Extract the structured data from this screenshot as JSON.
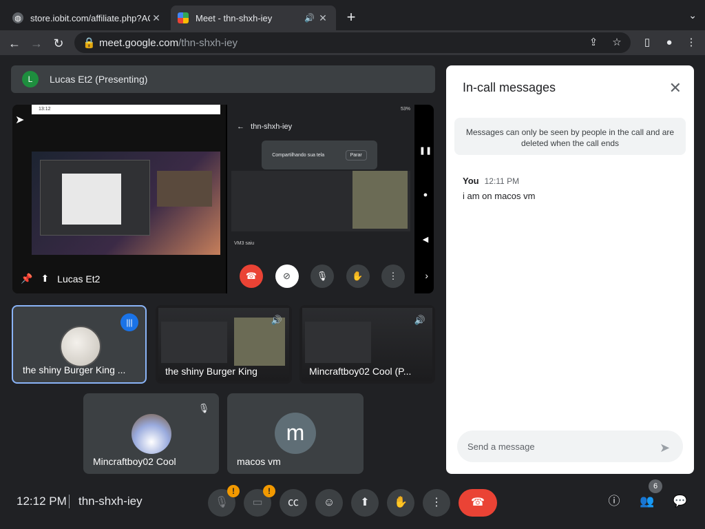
{
  "browser": {
    "tabs": [
      {
        "title": "store.iobit.com/affiliate.php?AC",
        "active": false
      },
      {
        "title": "Meet - thn-shxh-iey",
        "active": true
      }
    ],
    "url_host": "meet.google.com",
    "url_path": "/thn-shxh-iey"
  },
  "stage": {
    "presenter_initial": "L",
    "presenter_label": "Lucas Et2 (Presenting)",
    "main_tile_name": "Lucas Et2",
    "screen": {
      "desktop_clock": "13:12",
      "phone_status": "53%",
      "phone_title": "thn-shxh-iey",
      "share_text": "Compartilhando sua tela",
      "stop_label": "Parar",
      "left_msg": "VM3 saiu"
    }
  },
  "participants": [
    {
      "name": "the shiny Burger King ...",
      "speaking": true
    },
    {
      "name": "the shiny Burger King",
      "speaking": false
    },
    {
      "name": "Mincraftboy02 Cool (P...",
      "speaking": false
    },
    {
      "name": "Mincraftboy02 Cool",
      "speaking": false,
      "muted": true
    },
    {
      "name": "macos vm",
      "initial": "m"
    }
  ],
  "chat": {
    "title": "In-call messages",
    "notice": "Messages can only be seen by people in the call and are deleted when the call ends",
    "messages": [
      {
        "sender": "You",
        "time": "12:11 PM",
        "text": "i am on macos vm"
      }
    ],
    "input_placeholder": "Send a message"
  },
  "bottom": {
    "time": "12:12 PM",
    "meeting_code": "thn-shxh-iey",
    "participant_count": "6",
    "warn_mark": "!"
  },
  "colors": {
    "accent": "#1a73e8",
    "hangup": "#ea4335",
    "warning": "#f29900",
    "speaking_outline": "#8ab4f8"
  }
}
